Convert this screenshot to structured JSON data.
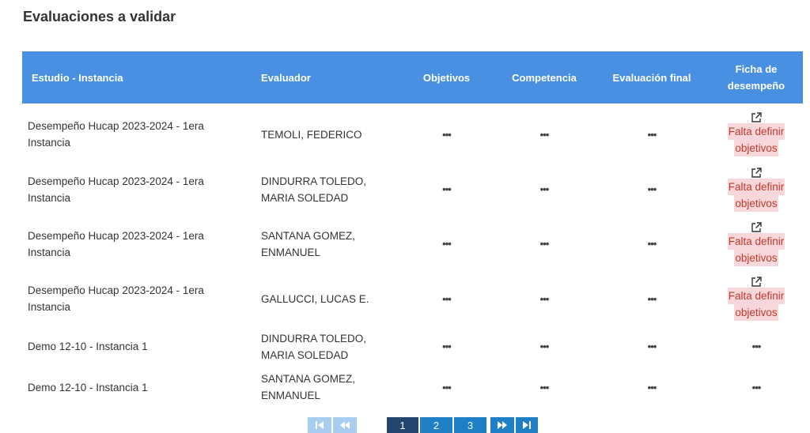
{
  "page": {
    "title": "Evaluaciones a validar"
  },
  "table": {
    "headers": {
      "study": "Estudio - Instancia",
      "evaluator": "Evaluador",
      "objectives": "Objetivos",
      "competence": "Competencia",
      "final": "Evaluación final",
      "ficha_line1": "Ficha de",
      "ficha_line2": "desempeño"
    },
    "dots": "•••",
    "warning_line1": "Falta definir",
    "warning_line2": "objetivos",
    "rows": [
      {
        "study_line1": "Desempeño Hucap 2023-2024 - 1era",
        "study_line2": "Instancia",
        "evaluator_line1": "TEMOLI, FEDERICO",
        "evaluator_line2": ""
      },
      {
        "study_line1": "Desempeño Hucap 2023-2024 - 1era",
        "study_line2": "Instancia",
        "evaluator_line1": "DINDURRA TOLEDO,",
        "evaluator_line2": "MARIA SOLEDAD"
      },
      {
        "study_line1": "Desempeño Hucap 2023-2024 - 1era",
        "study_line2": "Instancia",
        "evaluator_line1": "SANTANA GOMEZ,",
        "evaluator_line2": "ENMANUEL"
      },
      {
        "study_line1": "Desempeño Hucap 2023-2024 - 1era",
        "study_line2": "Instancia",
        "evaluator_line1": "GALLUCCI, LUCAS E.",
        "evaluator_line2": ""
      },
      {
        "study_line1": "Demo 12-10 - Instancia 1",
        "study_line2": "",
        "evaluator_line1": "DINDURRA TOLEDO,",
        "evaluator_line2": "MARIA SOLEDAD"
      },
      {
        "study_line1": "Demo 12-10 - Instancia 1",
        "study_line2": "",
        "evaluator_line1": "SANTANA GOMEZ,",
        "evaluator_line2": "ENMANUEL"
      }
    ]
  },
  "pagination": {
    "pages": [
      "1",
      "2",
      "3"
    ],
    "current": "1",
    "icons": {
      "first": "first-page-icon",
      "prev": "prev-page-icon",
      "next": "next-page-icon",
      "last": "last-page-icon"
    }
  },
  "colors": {
    "header_bg": "#4a90e2",
    "warning_bg": "#f8d7da",
    "warning_text": "#c0392b",
    "pager_active": "#23466e",
    "pager": "#1f7fc4"
  }
}
